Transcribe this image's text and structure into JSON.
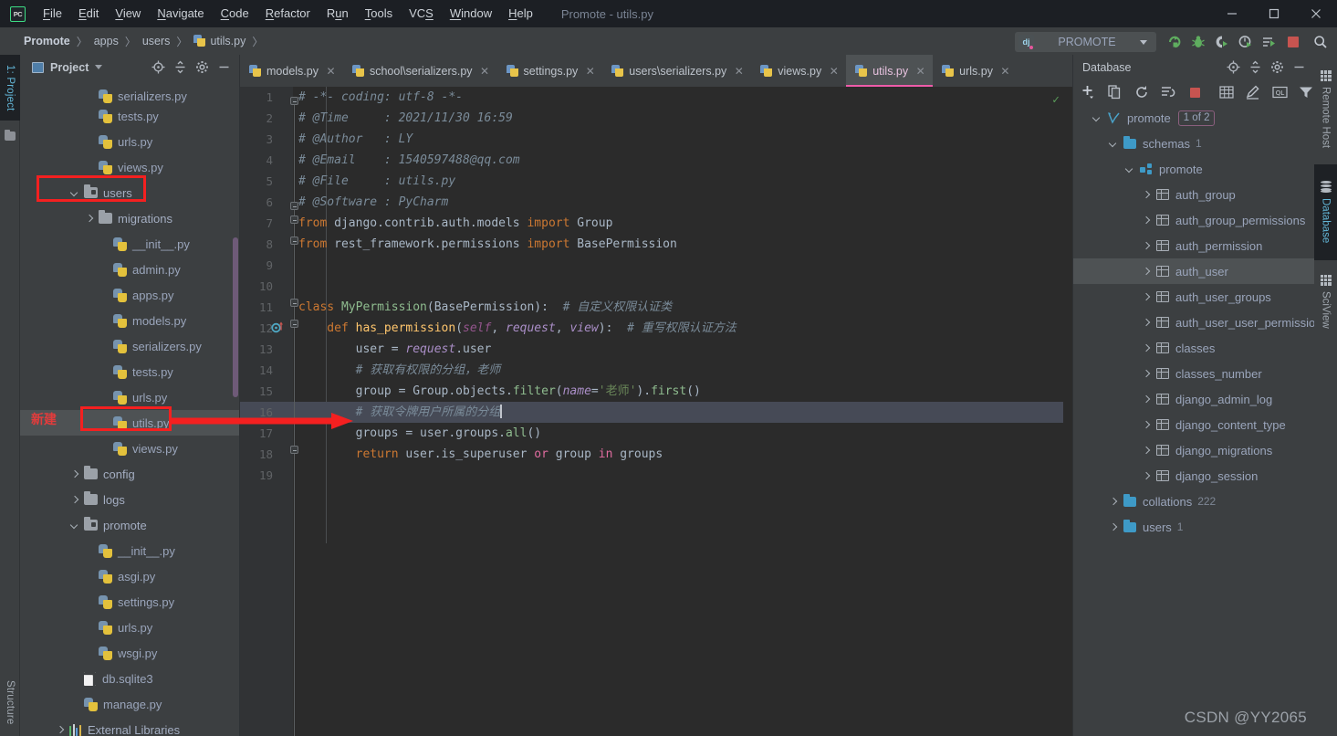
{
  "window": {
    "title": "Promote - utils.py",
    "logo_text": "PC",
    "controls": {
      "minimize": "—",
      "maximize": "□",
      "close": "✕"
    }
  },
  "menubar": {
    "items": [
      {
        "label": "File",
        "mnemonic": "F"
      },
      {
        "label": "Edit",
        "mnemonic": "E"
      },
      {
        "label": "View",
        "mnemonic": "V"
      },
      {
        "label": "Navigate",
        "mnemonic": "N"
      },
      {
        "label": "Code",
        "mnemonic": "C"
      },
      {
        "label": "Refactor",
        "mnemonic": "R"
      },
      {
        "label": "Run",
        "mnemonic": "u"
      },
      {
        "label": "Tools",
        "mnemonic": "T"
      },
      {
        "label": "VCS",
        "mnemonic": "S"
      },
      {
        "label": "Window",
        "mnemonic": "W"
      },
      {
        "label": "Help",
        "mnemonic": "H"
      }
    ]
  },
  "breadcrumb": {
    "items": [
      "Promote",
      "apps",
      "users",
      "utils.py"
    ],
    "separator": "〉"
  },
  "run_config": {
    "name": "PROMOTE",
    "icon": "django-icon",
    "dropdown": "chevron-down-icon",
    "actions": [
      "run-button",
      "debug-button",
      "run-coverage-button",
      "profile-button",
      "run-with-console-button",
      "stop-button",
      "search-everywhere-button"
    ]
  },
  "left_toolbar": {
    "tabs": [
      {
        "label": "1: Project",
        "active": true
      },
      {
        "label": "Structure",
        "active": false
      }
    ]
  },
  "project_panel": {
    "title": "Project",
    "header_icons": [
      "locate-icon",
      "collapse-all-icon",
      "settings-gear-icon",
      "hide-icon"
    ],
    "annotation_badge": "新建",
    "tree": [
      {
        "label": "serializers.py",
        "indent": 4,
        "type": "py",
        "arrow": "none",
        "partial": true
      },
      {
        "label": "tests.py",
        "indent": 4,
        "type": "py",
        "arrow": "none"
      },
      {
        "label": "urls.py",
        "indent": 4,
        "type": "py",
        "arrow": "none"
      },
      {
        "label": "views.py",
        "indent": 4,
        "type": "py",
        "arrow": "none"
      },
      {
        "label": "users",
        "indent": 3,
        "type": "module-folder",
        "arrow": "down",
        "highlight": "red-box"
      },
      {
        "label": "migrations",
        "indent": 4,
        "type": "folder",
        "arrow": "right"
      },
      {
        "label": "__init__.py",
        "indent": 5,
        "type": "py",
        "arrow": "none"
      },
      {
        "label": "admin.py",
        "indent": 5,
        "type": "py",
        "arrow": "none"
      },
      {
        "label": "apps.py",
        "indent": 5,
        "type": "py",
        "arrow": "none"
      },
      {
        "label": "models.py",
        "indent": 5,
        "type": "py",
        "arrow": "none"
      },
      {
        "label": "serializers.py",
        "indent": 5,
        "type": "py",
        "arrow": "none"
      },
      {
        "label": "tests.py",
        "indent": 5,
        "type": "py",
        "arrow": "none"
      },
      {
        "label": "urls.py",
        "indent": 5,
        "type": "py",
        "arrow": "none"
      },
      {
        "label": "utils.py",
        "indent": 5,
        "type": "py",
        "arrow": "none",
        "selected": true,
        "highlight": "red-box"
      },
      {
        "label": "views.py",
        "indent": 5,
        "type": "py",
        "arrow": "none"
      },
      {
        "label": "config",
        "indent": 3,
        "type": "folder",
        "arrow": "right"
      },
      {
        "label": "logs",
        "indent": 3,
        "type": "folder",
        "arrow": "right"
      },
      {
        "label": "promote",
        "indent": 3,
        "type": "module-folder",
        "arrow": "down"
      },
      {
        "label": "__init__.py",
        "indent": 4,
        "type": "py",
        "arrow": "none"
      },
      {
        "label": "asgi.py",
        "indent": 4,
        "type": "py",
        "arrow": "none"
      },
      {
        "label": "settings.py",
        "indent": 4,
        "type": "py",
        "arrow": "none"
      },
      {
        "label": "urls.py",
        "indent": 4,
        "type": "py",
        "arrow": "none"
      },
      {
        "label": "wsgi.py",
        "indent": 4,
        "type": "py",
        "arrow": "none"
      },
      {
        "label": "db.sqlite3",
        "indent": 3,
        "type": "file",
        "arrow": "none"
      },
      {
        "label": "manage.py",
        "indent": 3,
        "type": "py",
        "arrow": "none"
      },
      {
        "label": "External Libraries",
        "indent": 2,
        "type": "library",
        "arrow": "right"
      }
    ]
  },
  "editor_tabs": {
    "tabs": [
      {
        "label": "models.py",
        "active": false,
        "close": "✕"
      },
      {
        "label": "school\\serializers.py",
        "active": false,
        "close": "✕"
      },
      {
        "label": "settings.py",
        "active": false,
        "close": "✕"
      },
      {
        "label": "users\\serializers.py",
        "active": false,
        "close": "✕"
      },
      {
        "label": "views.py",
        "active": false,
        "close": "✕"
      },
      {
        "label": "utils.py",
        "active": true,
        "close": "✕"
      },
      {
        "label": "urls.py",
        "active": false,
        "close": "✕"
      }
    ]
  },
  "editor": {
    "filename": "utils.py",
    "inspection_status": "✓",
    "current_line": 16,
    "lines": [
      {
        "n": 1,
        "tokens": [
          {
            "t": "# -*- coding: utf-8 -*-",
            "c": "c-com"
          }
        ]
      },
      {
        "n": 2,
        "tokens": [
          {
            "t": "# @Time     : 2021/11/30 16:59",
            "c": "c-com"
          }
        ]
      },
      {
        "n": 3,
        "tokens": [
          {
            "t": "# @Author   : LY",
            "c": "c-com"
          }
        ]
      },
      {
        "n": 4,
        "tokens": [
          {
            "t": "# @Email    : 1540597488@qq.com",
            "c": "c-com"
          }
        ]
      },
      {
        "n": 5,
        "tokens": [
          {
            "t": "# @File     : utils.py",
            "c": "c-com"
          }
        ]
      },
      {
        "n": 6,
        "tokens": [
          {
            "t": "# @Software : PyCharm",
            "c": "c-com"
          }
        ]
      },
      {
        "n": 7,
        "tokens": [
          {
            "t": "from ",
            "c": "c-kw"
          },
          {
            "t": "django.contrib.auth.models ",
            "c": "c-txt"
          },
          {
            "t": "import ",
            "c": "c-kw"
          },
          {
            "t": "Group",
            "c": "c-txt"
          }
        ]
      },
      {
        "n": 8,
        "tokens": [
          {
            "t": "from ",
            "c": "c-kw"
          },
          {
            "t": "rest_framework.permissions ",
            "c": "c-txt"
          },
          {
            "t": "import ",
            "c": "c-kw"
          },
          {
            "t": "BasePermission",
            "c": "c-txt"
          }
        ]
      },
      {
        "n": 9,
        "tokens": []
      },
      {
        "n": 10,
        "tokens": []
      },
      {
        "n": 11,
        "tokens": [
          {
            "t": "class ",
            "c": "c-kw"
          },
          {
            "t": "MyPermission",
            "c": "c-meth"
          },
          {
            "t": "(BasePermission):",
            "c": "c-txt"
          },
          {
            "t": "  # 自定义权限认证类",
            "c": "c-com"
          }
        ]
      },
      {
        "n": 12,
        "tokens": [
          {
            "t": "    def ",
            "c": "c-kw"
          },
          {
            "t": "has_permission",
            "c": "c-fn"
          },
          {
            "t": "(",
            "c": "c-txt"
          },
          {
            "t": "self",
            "c": "c-self"
          },
          {
            "t": ", ",
            "c": "c-txt"
          },
          {
            "t": "request",
            "c": "c-param"
          },
          {
            "t": ", ",
            "c": "c-txt"
          },
          {
            "t": "view",
            "c": "c-param"
          },
          {
            "t": "):",
            "c": "c-txt"
          },
          {
            "t": "  # 重写权限认证方法",
            "c": "c-com"
          }
        ]
      },
      {
        "n": 13,
        "tokens": [
          {
            "t": "        user = ",
            "c": "c-txt"
          },
          {
            "t": "request",
            "c": "c-param"
          },
          {
            "t": ".user",
            "c": "c-txt"
          }
        ]
      },
      {
        "n": 14,
        "tokens": [
          {
            "t": "        # 获取有权限的分组，老师",
            "c": "c-com"
          }
        ]
      },
      {
        "n": 15,
        "tokens": [
          {
            "t": "        group = Group.objects.",
            "c": "c-txt"
          },
          {
            "t": "filter",
            "c": "c-meth"
          },
          {
            "t": "(",
            "c": "c-txt"
          },
          {
            "t": "name",
            "c": "c-param"
          },
          {
            "t": "=",
            "c": "c-txt"
          },
          {
            "t": "'老师'",
            "c": "c-str"
          },
          {
            "t": ").",
            "c": "c-txt"
          },
          {
            "t": "first",
            "c": "c-meth"
          },
          {
            "t": "()",
            "c": "c-txt"
          }
        ]
      },
      {
        "n": 16,
        "tokens": [
          {
            "t": "        # 获取令牌用户所属的分组",
            "c": "c-com"
          }
        ],
        "cursor": true,
        "current": true
      },
      {
        "n": 17,
        "tokens": [
          {
            "t": "        groups = user.groups.",
            "c": "c-txt"
          },
          {
            "t": "all",
            "c": "c-meth"
          },
          {
            "t": "()",
            "c": "c-txt"
          }
        ]
      },
      {
        "n": 18,
        "tokens": [
          {
            "t": "        return ",
            "c": "c-kw"
          },
          {
            "t": "user.is_superuser ",
            "c": "c-txt"
          },
          {
            "t": "or ",
            "c": "c-kw2"
          },
          {
            "t": "group ",
            "c": "c-txt"
          },
          {
            "t": "in ",
            "c": "c-kw2"
          },
          {
            "t": "groups",
            "c": "c-txt"
          }
        ]
      },
      {
        "n": 19,
        "tokens": []
      }
    ]
  },
  "database_panel": {
    "title": "Database",
    "header_icons": [
      "locate-icon",
      "collapse-all-icon",
      "settings-gear-icon",
      "hide-icon"
    ],
    "toolbar_icons": [
      "add-icon",
      "duplicate-icon",
      "refresh-icon",
      "sync-icon",
      "stop-icon",
      "table-icon",
      "edit-icon",
      "query-console-icon",
      "filter-icon"
    ],
    "tree": [
      {
        "label": "promote",
        "indent": 1,
        "type": "connection",
        "arrow": "down",
        "badge": "1 of 2"
      },
      {
        "label": "schemas",
        "indent": 2,
        "type": "folder",
        "arrow": "down",
        "count": "1"
      },
      {
        "label": "promote",
        "indent": 3,
        "type": "schema",
        "arrow": "down"
      },
      {
        "label": "auth_group",
        "indent": 4,
        "type": "table",
        "arrow": "right"
      },
      {
        "label": "auth_group_permissions",
        "indent": 4,
        "type": "table",
        "arrow": "right"
      },
      {
        "label": "auth_permission",
        "indent": 4,
        "type": "table",
        "arrow": "right"
      },
      {
        "label": "auth_user",
        "indent": 4,
        "type": "table",
        "arrow": "right",
        "selected": true
      },
      {
        "label": "auth_user_groups",
        "indent": 4,
        "type": "table",
        "arrow": "right"
      },
      {
        "label": "auth_user_user_permissions",
        "indent": 4,
        "type": "table",
        "arrow": "right"
      },
      {
        "label": "classes",
        "indent": 4,
        "type": "table",
        "arrow": "right"
      },
      {
        "label": "classes_number",
        "indent": 4,
        "type": "table",
        "arrow": "right"
      },
      {
        "label": "django_admin_log",
        "indent": 4,
        "type": "table",
        "arrow": "right"
      },
      {
        "label": "django_content_type",
        "indent": 4,
        "type": "table",
        "arrow": "right"
      },
      {
        "label": "django_migrations",
        "indent": 4,
        "type": "table",
        "arrow": "right"
      },
      {
        "label": "django_session",
        "indent": 4,
        "type": "table",
        "arrow": "right"
      },
      {
        "label": "collations",
        "indent": 2,
        "type": "folder",
        "arrow": "right",
        "count": "222"
      },
      {
        "label": "users",
        "indent": 2,
        "type": "folder",
        "arrow": "right",
        "count": "1"
      }
    ]
  },
  "right_toolbar": {
    "tabs": [
      {
        "label": "Remote Host",
        "active": false,
        "icon": "grid-icon"
      },
      {
        "label": "Database",
        "active": true,
        "icon": "database-cylinder-icon"
      },
      {
        "label": "SciView",
        "active": false,
        "icon": "grid-icon"
      }
    ]
  },
  "watermark": "CSDN @YY2065",
  "colors": {
    "accent_pink": "#ee5ba9",
    "annotation_red": "#f42020",
    "editor_bg": "#2b2b2b",
    "panel_bg": "#3c3f41",
    "titlebar_bg": "#1c1f24",
    "selection_bg": "#4e5254",
    "current_line_bg": "#464a56",
    "link_blue": "#62b5d6"
  }
}
